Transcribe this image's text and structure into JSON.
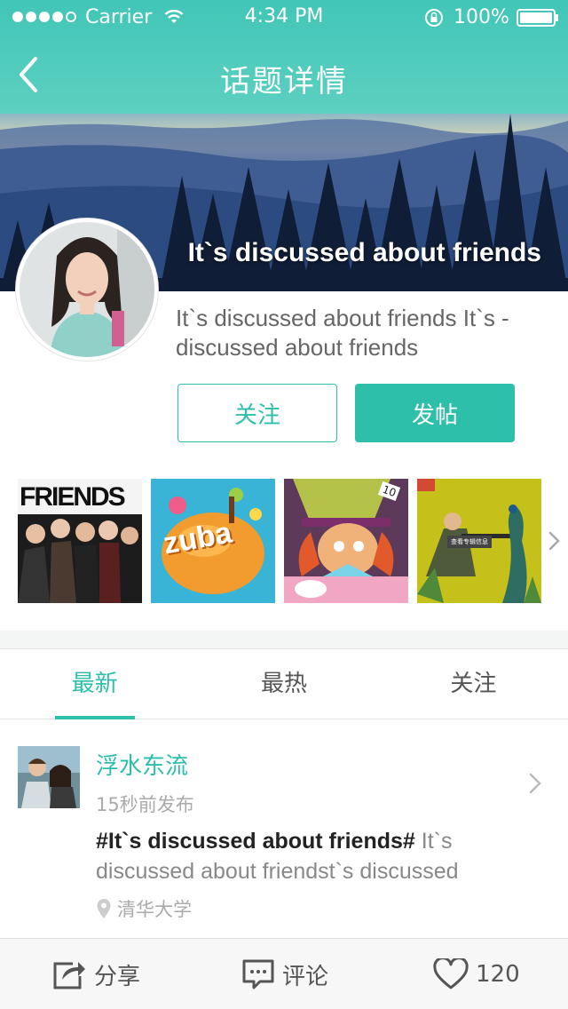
{
  "status_bar": {
    "carrier": "Carrier",
    "time": "4:34 PM",
    "battery": "100%"
  },
  "nav": {
    "title": "话题详情",
    "back_icon": "chevron-left-icon"
  },
  "topic": {
    "banner_title": "It`s discussed about friends",
    "description": "It`s discussed about friends It`s - discussed about friends",
    "follow_label": "关注",
    "post_label": "发帖"
  },
  "thumbnails": [
    {
      "caption": "FRIENDS"
    },
    {
      "caption": "zuba"
    },
    {
      "caption": "10"
    },
    {
      "caption": "查看专辑信息"
    }
  ],
  "tabs": [
    {
      "label": "最新",
      "active": true
    },
    {
      "label": "最热",
      "active": false
    },
    {
      "label": "关注",
      "active": false
    }
  ],
  "post": {
    "author": "浮水东流",
    "time": "15秒前发布",
    "tag": "#It`s discussed about friends#",
    "text": " It`s discussed about friendst`s discussed",
    "location": "清华大学"
  },
  "bottom_bar": {
    "share_label": "分享",
    "comment_label": "评论",
    "like_count": "120"
  },
  "colors": {
    "accent": "#2dbfa9",
    "header": "#4cc9b9"
  }
}
